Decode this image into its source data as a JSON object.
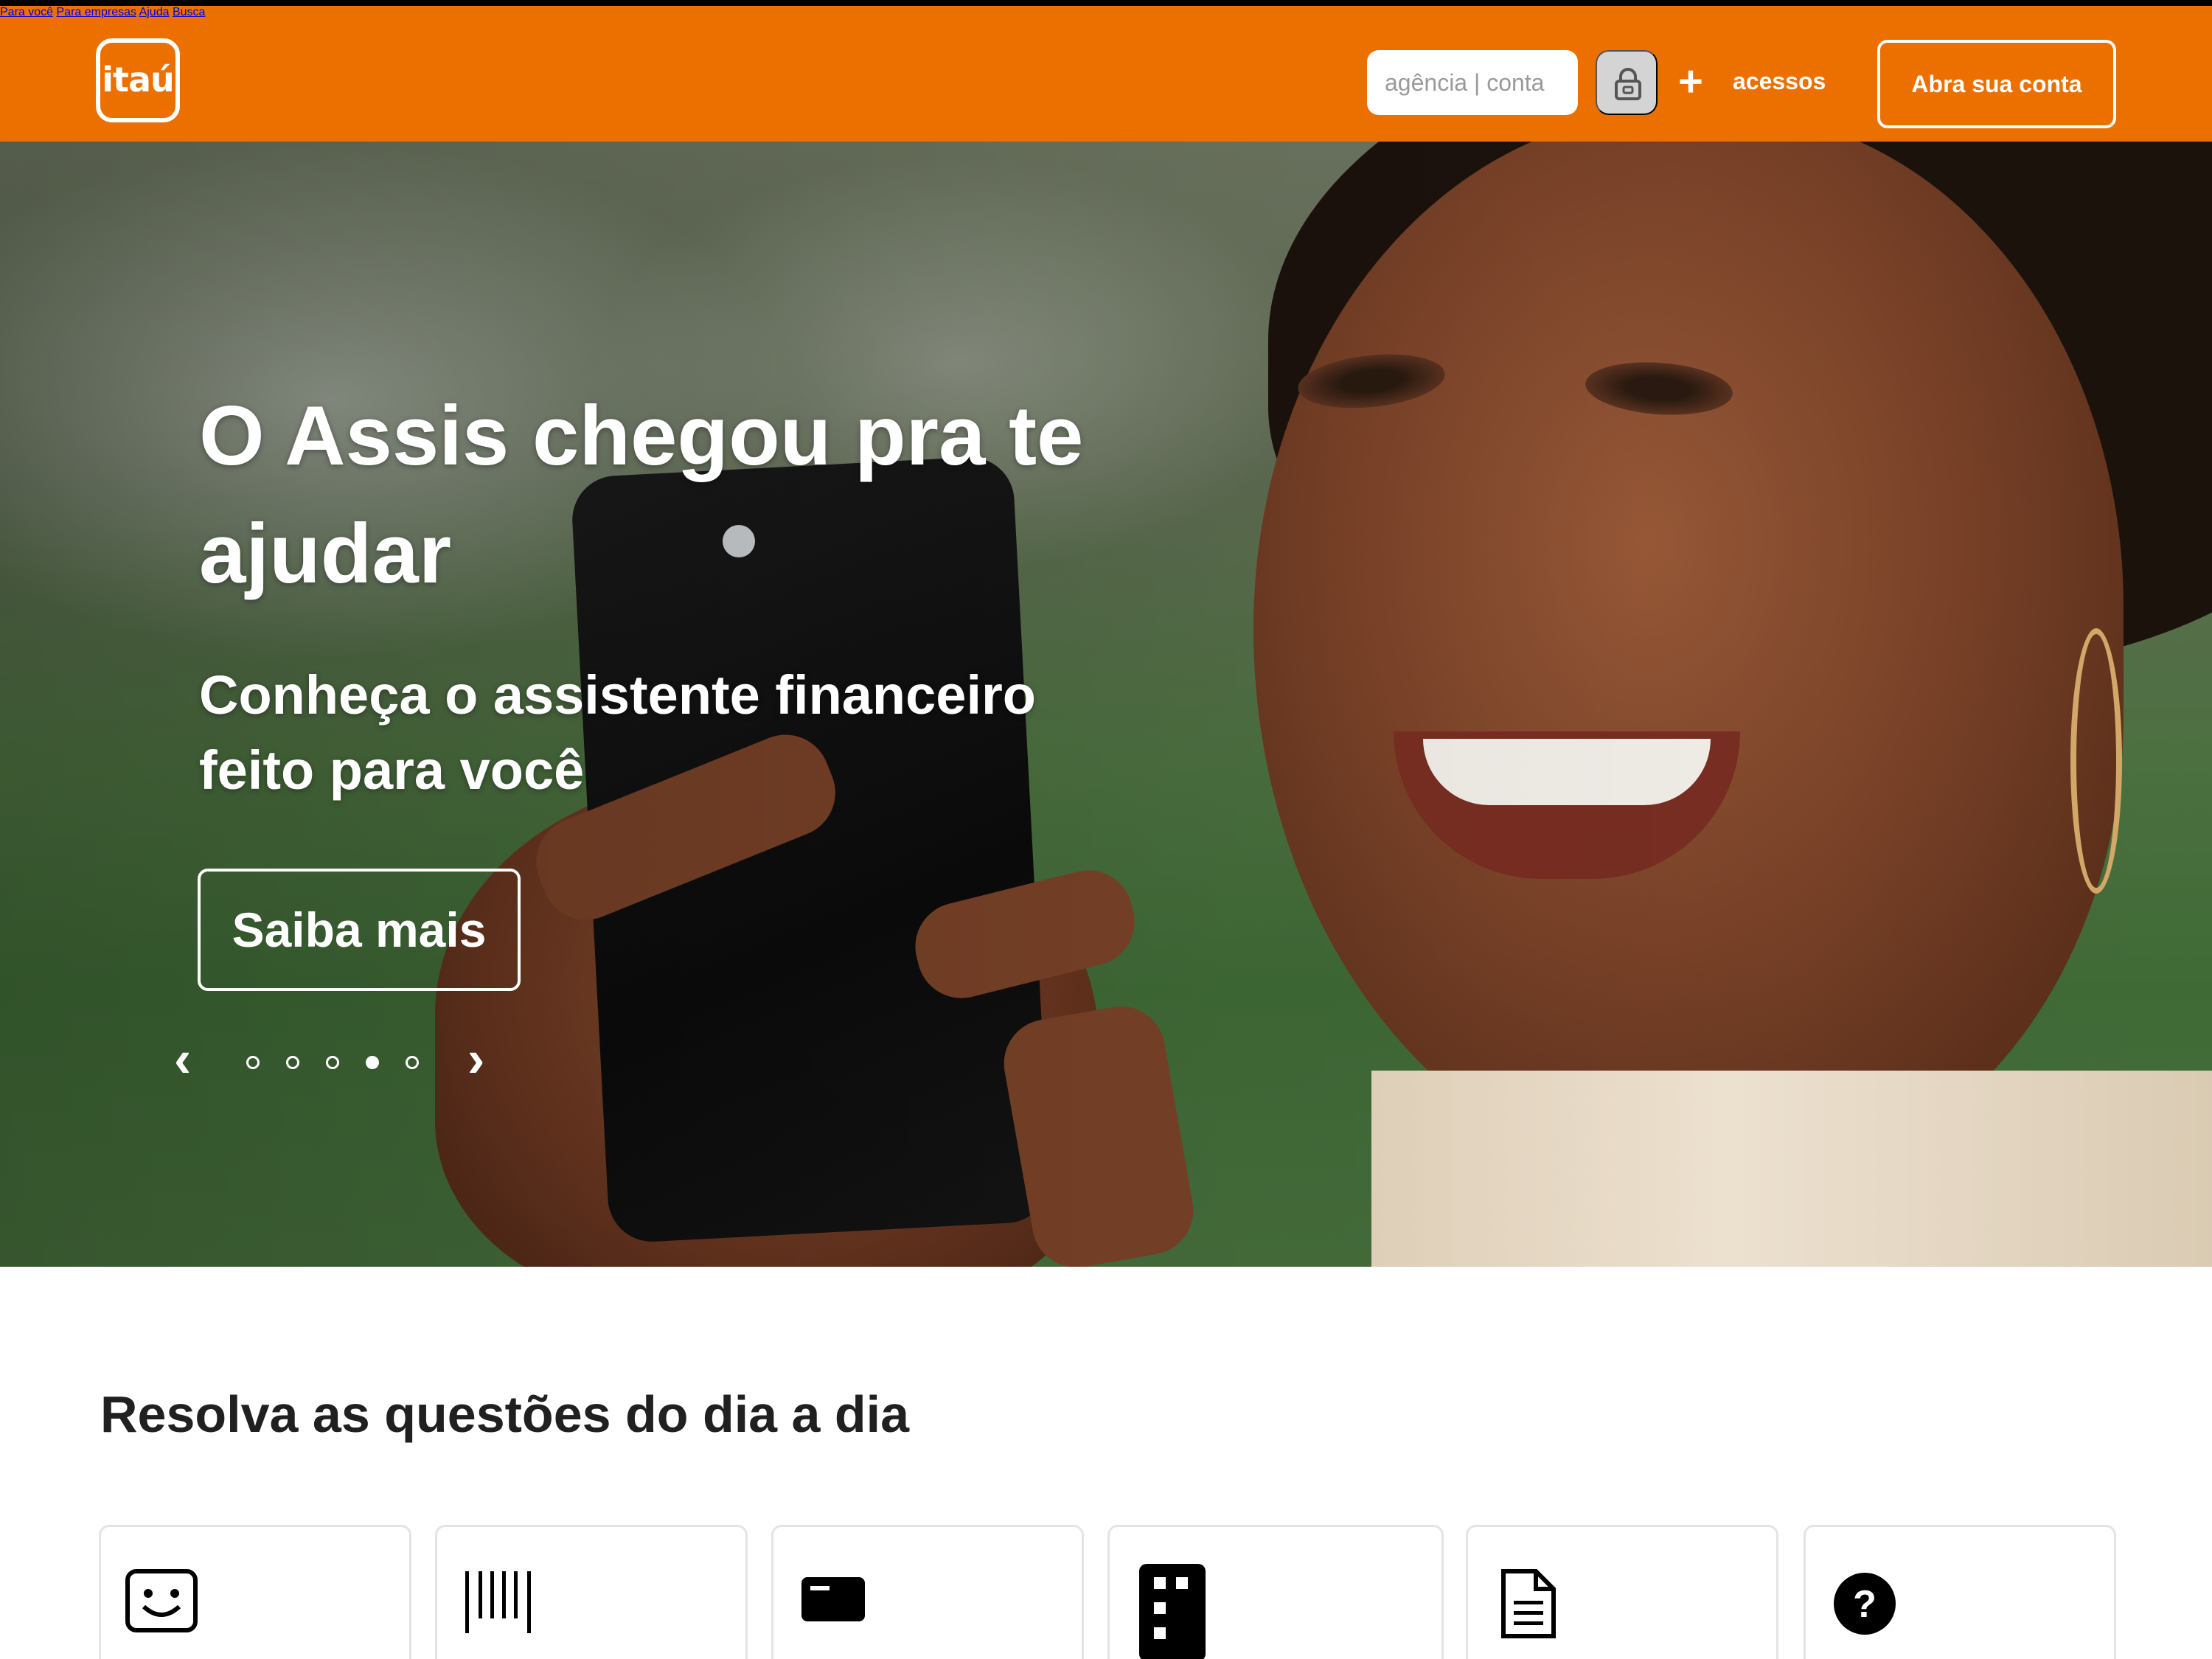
{
  "header": {
    "logo_text": "itaú",
    "nav": [
      {
        "label": "Para você"
      },
      {
        "label": "Para empresas"
      },
      {
        "label": "Ajuda"
      },
      {
        "label": "Busca"
      }
    ],
    "login_placeholder": "agência | conta",
    "access_label": "acessos",
    "open_account_label": "Abra sua conta",
    "brand_color": "#ec7000"
  },
  "hero": {
    "title": "O Assis chegou pra te ajudar",
    "subtitle": "Conheça o assistente financeiro feito para você",
    "cta_label": "Saiba mais",
    "carousel": {
      "total": 5,
      "active_index": 4
    }
  },
  "section": {
    "title": "Resolva as questões do dia a dia",
    "cards": [
      {
        "icon": "smiley-face-icon"
      },
      {
        "icon": "barcode-icon"
      },
      {
        "icon": "card-icon"
      },
      {
        "icon": "token-icon"
      },
      {
        "icon": "document-icon"
      },
      {
        "icon": "help-circle-icon"
      }
    ]
  }
}
